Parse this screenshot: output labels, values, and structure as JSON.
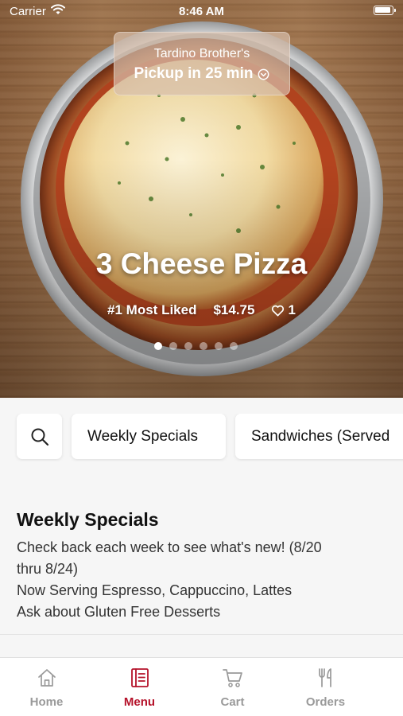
{
  "status_bar": {
    "carrier": "Carrier",
    "time": "8:46 AM"
  },
  "pickup": {
    "restaurant": "Tardino Brother's",
    "label": "Pickup in 25 min"
  },
  "featured": {
    "title": "3 Cheese Pizza",
    "rank": "#1 Most Liked",
    "price": "$14.75",
    "likes": "1",
    "slides_total": 6,
    "slide_active": 1
  },
  "categories": {
    "search_icon": "search-icon",
    "tabs": [
      {
        "label": "Weekly Specials"
      },
      {
        "label": "Sandwiches (Served"
      }
    ]
  },
  "section": {
    "title": "Weekly Specials",
    "description": [
      "Check back each week to see what's new! (8/20",
      "thru 8/24)",
      "Now Serving Espresso, Cappuccino, Lattes",
      "Ask about Gluten Free Desserts"
    ]
  },
  "nav": {
    "items": [
      {
        "label": "Home",
        "icon": "home-icon"
      },
      {
        "label": "Menu",
        "icon": "menu-icon",
        "active": true
      },
      {
        "label": "Cart",
        "icon": "cart-icon"
      },
      {
        "label": "Orders",
        "icon": "utensils-icon"
      }
    ],
    "active_color": "#b5122a",
    "inactive_color": "#9a9a9a"
  }
}
